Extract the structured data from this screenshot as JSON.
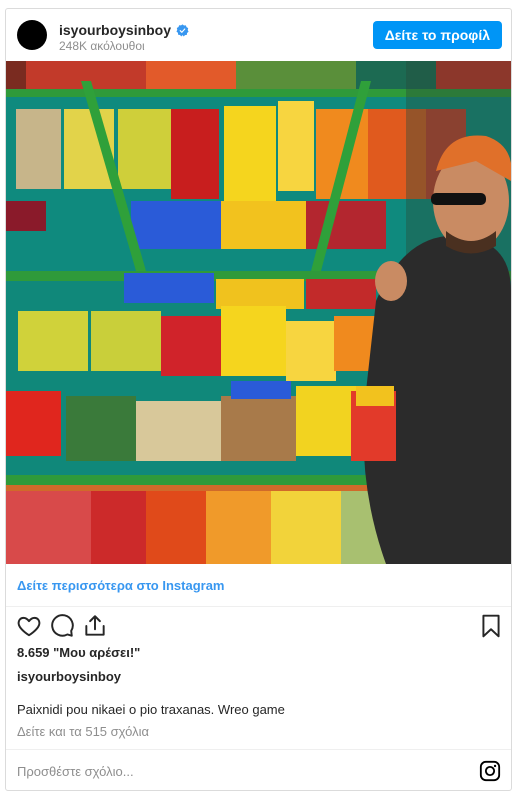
{
  "header": {
    "username": "isyourboysinboy",
    "followers": "248K ακόλουθοι",
    "profile_button": "Δείτε το προφίλ"
  },
  "media": {
    "alt_icon": "fruit-stand-photo"
  },
  "more_link": "Δείτε περισσότερα στο Instagram",
  "actions": {
    "icons": [
      "heart-icon",
      "comment-icon",
      "share-icon",
      "bookmark-icon"
    ]
  },
  "post": {
    "likes": "8.659 \"Μου αρέσει!\"",
    "author": "isyourboysinboy",
    "caption": "Paixnidi pou nikaei o pio traxanas. Wreo game",
    "comments_link": "Δείτε και τα 515 σχόλια"
  },
  "comment_box": {
    "placeholder": "Προσθέστε σχόλιο..."
  },
  "colors": {
    "accent": "#0095f6",
    "link": "#3897f0",
    "muted": "#8e8e8e"
  }
}
